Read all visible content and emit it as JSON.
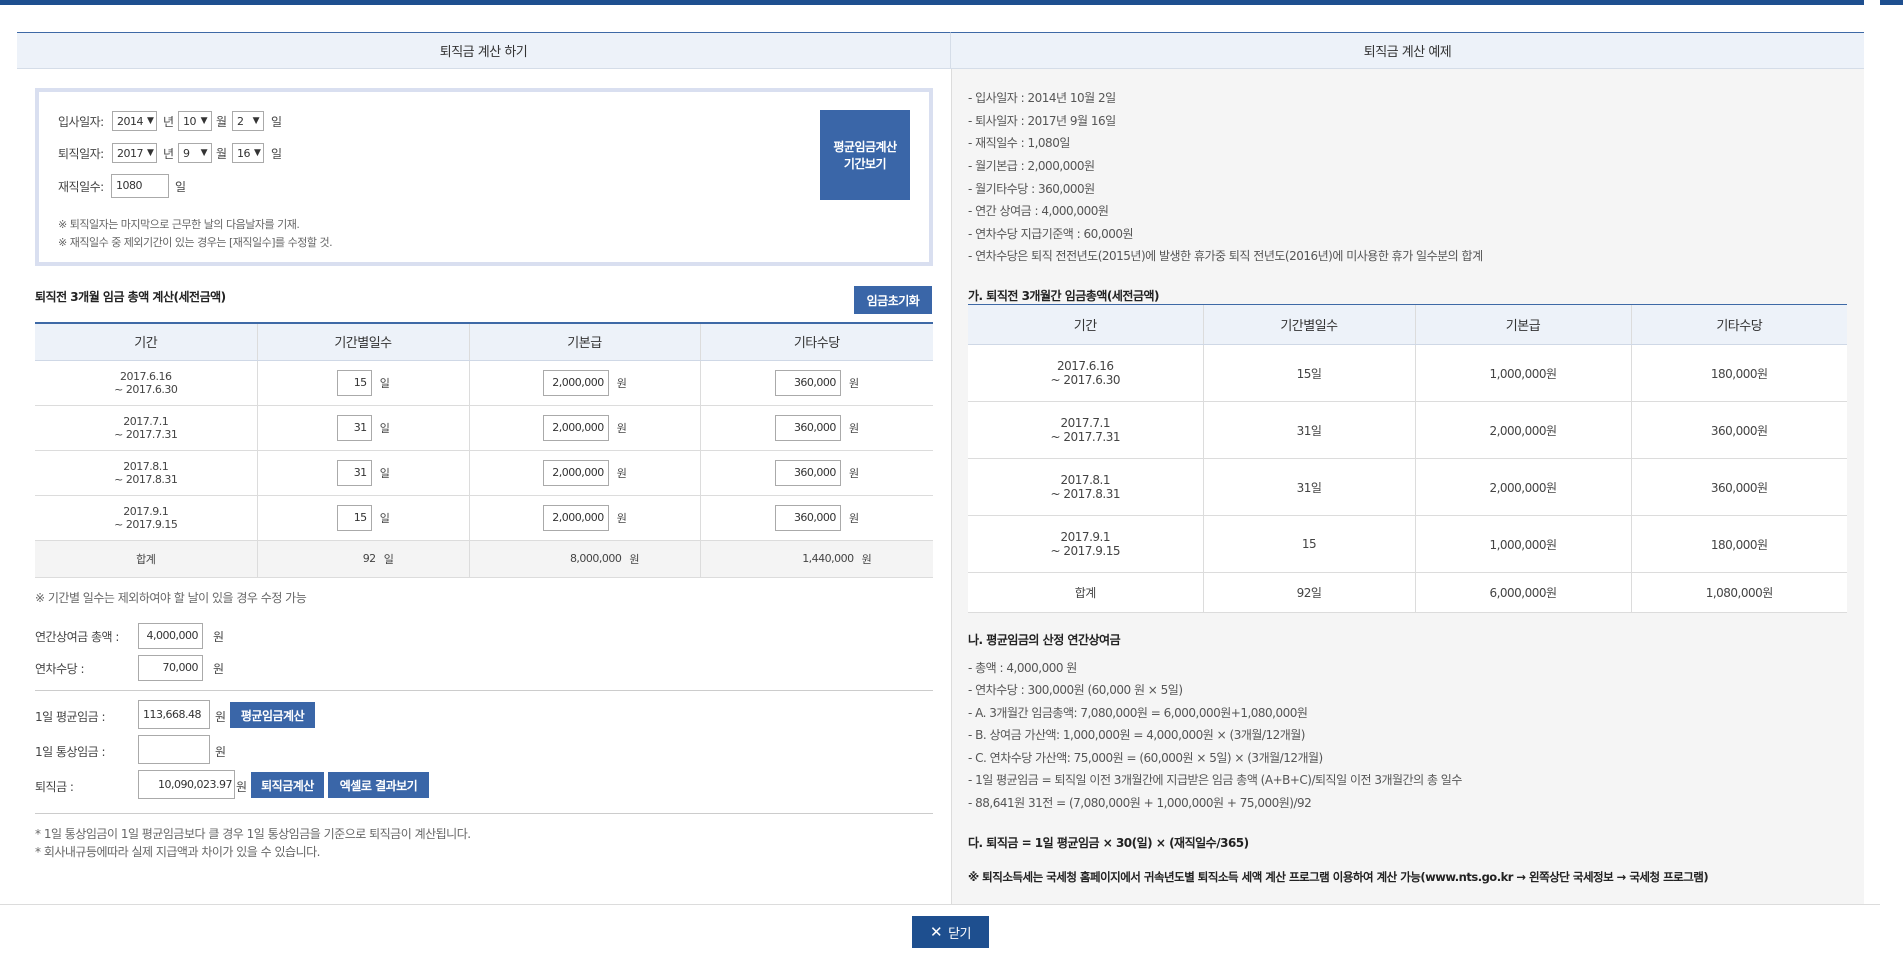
{
  "left_header": "퇴직금 계산 하기",
  "right_header": "퇴직금 계산 예제",
  "form": {
    "join_label": "입사일자:",
    "join_year": "2014",
    "join_month": "10",
    "join_day": "2",
    "leave_label": "퇴직일자:",
    "leave_year": "2017",
    "leave_month": "9",
    "leave_day": "16",
    "unit_year": "년",
    "unit_month": "월",
    "unit_day": "일",
    "days_label": "재직일수:",
    "days_value": "1080",
    "note1": "※ 퇴직일자는 마지막으로 근무한 날의 다음날자를 기재.",
    "note2": "※ 재직일수 중 제외기간이 있는 경우는 [재직일수]를 수정할 것.",
    "period_button_line1": "평균임금계산",
    "period_button_line2": "기간보기"
  },
  "wage_section": {
    "title": "퇴직전 3개월 임금 총액 계산(세전금액)",
    "reset_button": "임금초기화",
    "columns": [
      "기간",
      "기간별일수",
      "기본급",
      "기타수당"
    ],
    "rows": [
      {
        "period1": "2017.6.16",
        "period2": "~ 2017.6.30",
        "days": "15",
        "base": "2,000,000",
        "other": "360,000"
      },
      {
        "period1": "2017.7.1",
        "period2": "~ 2017.7.31",
        "days": "31",
        "base": "2,000,000",
        "other": "360,000"
      },
      {
        "period1": "2017.8.1",
        "period2": "~ 2017.8.31",
        "days": "31",
        "base": "2,000,000",
        "other": "360,000"
      },
      {
        "period1": "2017.9.1",
        "period2": "~ 2017.9.15",
        "days": "15",
        "base": "2,000,000",
        "other": "360,000"
      }
    ],
    "sum_label": "합계",
    "sum_days": "92",
    "sum_base": "8,000,000",
    "sum_other": "1,440,000",
    "unit_day": "일",
    "unit_won": "원",
    "note": "※ 기간별 일수는 제외하여야 할 날이 있을 경우 수정 가능"
  },
  "bonus": {
    "bonus_label": "연간상여금 총액 :",
    "bonus_value": "4,000,000",
    "leave_pay_label": "연차수당 :",
    "leave_pay_value": "70,000",
    "unit_won": "원"
  },
  "results": {
    "avg_label": "1일 평균임금 :",
    "avg_value": "113,668.48",
    "avg_button": "평균임금계산",
    "ordinary_label": "1일 통상임금 :",
    "ordinary_value": "",
    "severance_label": "퇴직금 :",
    "severance_value": "10,090,023.97",
    "severance_button": "퇴직금계산",
    "excel_button": "엑셀로 결과보기",
    "unit_won": "원",
    "footnote1": "* 1일 통상임금이 1일 평균임금보다 클 경우 1일 통상임금을 기준으로 퇴직금이 계산됩니다.",
    "footnote2": "* 회사내규등에따라 실제 지급액과 차이가 있을 수 있습니다."
  },
  "example": {
    "lines": [
      "- 입사일자 : 2014년 10월 2일",
      "- 퇴사일자 : 2017년 9월 16일",
      "- 재직일수 : 1,080일",
      "- 월기본급 : 2,000,000원",
      "- 월기타수당 : 360,000원",
      "- 연간 상여금 : 4,000,000원",
      "- 연차수당 지급기준액 : 60,000원",
      "- 연차수당은 퇴직 전전년도(2015년)에 발생한 휴가중 퇴직 전년도(2016년)에 미사용한 휴가 일수분의 합계"
    ],
    "table_title": "가. 퇴직전 3개월간 임금총액(세전금액)",
    "columns": [
      "기간",
      "기간별일수",
      "기본급",
      "기타수당"
    ],
    "rows": [
      {
        "period1": "2017.6.16",
        "period2": "~ 2017.6.30",
        "days": "15일",
        "base": "1,000,000원",
        "other": "180,000원"
      },
      {
        "period1": "2017.7.1",
        "period2": "~ 2017.7.31",
        "days": "31일",
        "base": "2,000,000원",
        "other": "360,000원"
      },
      {
        "period1": "2017.8.1",
        "period2": "~ 2017.8.31",
        "days": "31일",
        "base": "2,000,000원",
        "other": "360,000원"
      },
      {
        "period1": "2017.9.1",
        "period2": "~ 2017.9.15",
        "days": "15",
        "base": "1,000,000원",
        "other": "180,000원"
      }
    ],
    "sum_label": "합계",
    "sum_days": "92일",
    "sum_base": "6,000,000원",
    "sum_other": "1,080,000원",
    "section_b_title": "나. 평균임금의 산정 연간상여금",
    "section_b_lines": [
      "- 총액 : 4,000,000 원",
      "- 연차수당 : 300,000원 (60,000 원 × 5일)",
      "- A. 3개월간 임금총액: 7,080,000원 = 6,000,000원+1,080,000원",
      "- B. 상여금 가산액: 1,000,000원 = 4,000,000원 × (3개월/12개월)",
      "- C. 연차수당 가산액: 75,000원 = (60,000원 × 5일) × (3개월/12개월)",
      "- 1일 평균임금 = 퇴직일 이전 3개월간에 지급받은 임금 총액 (A+B+C)/퇴직일 이전 3개월간의 총 일수",
      "- 88,641원 31전 = (7,080,000원 + 1,000,000원 + 75,000원)/92"
    ],
    "section_c_title": "다. 퇴직금 = 1일 평균임금 × 30(일) × (재직일수/365)",
    "tax_note": "※ 퇴직소득세는 국세청 홈페이지에서 귀속년도별 퇴직소득 세액 계산 프로그램 이용하여 계산 가능(www.nts.go.kr → 왼쪽상단 국세정보 → 국세청 프로그램)"
  },
  "close_button": "닫기",
  "icons": {
    "dropdown": "chevron-down-icon",
    "close": "close-icon"
  },
  "colors": {
    "primary": "#3a66a8",
    "dark": "#1e4f8f",
    "header_bg": "#edf2f9"
  }
}
